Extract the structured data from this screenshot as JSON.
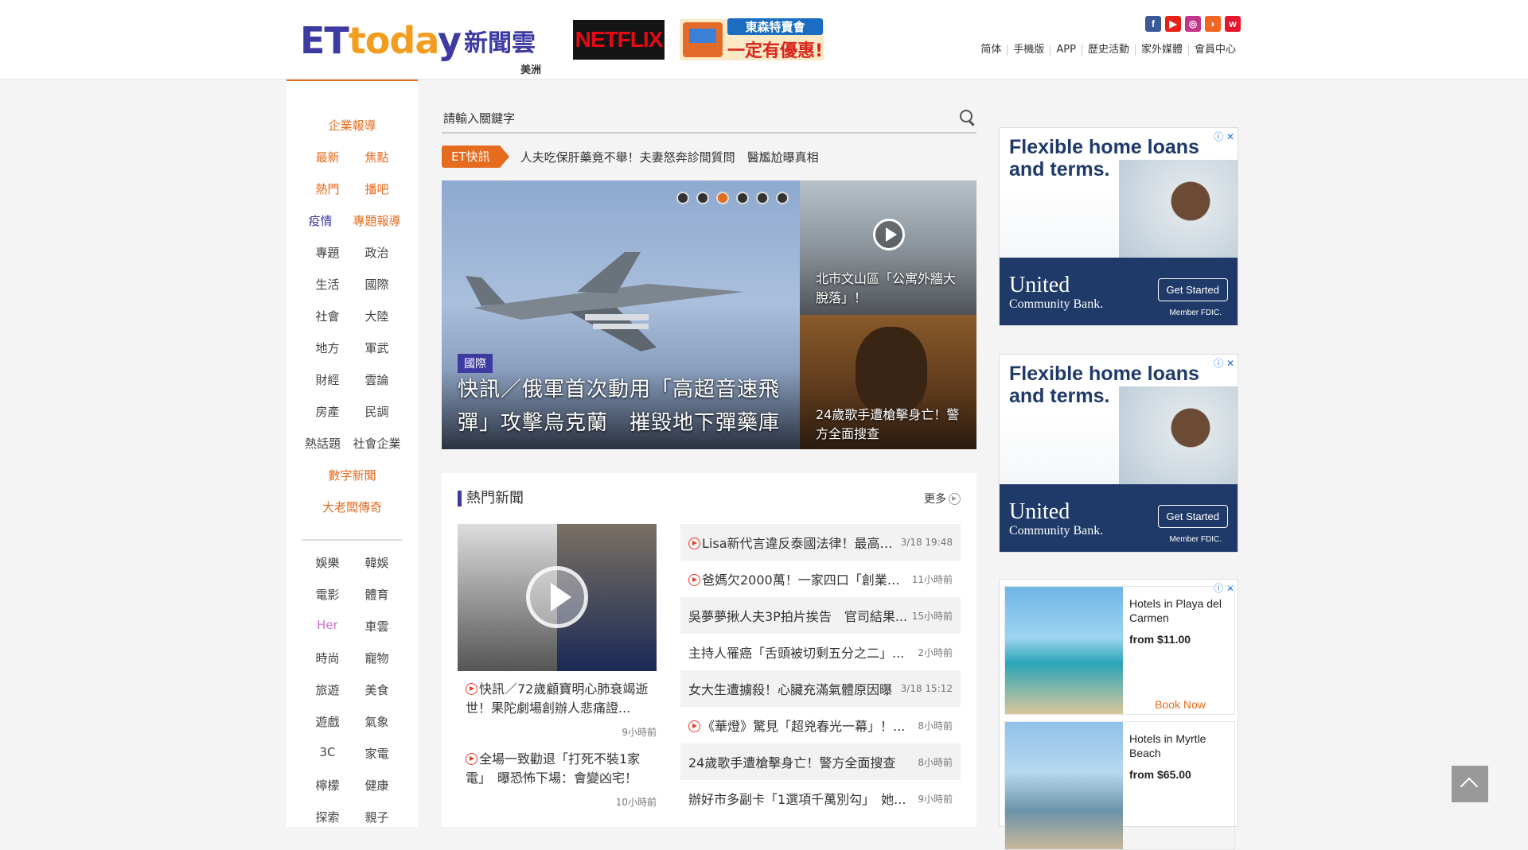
{
  "header": {
    "logo_en": "ETtoday",
    "logo_cn": "新聞雲",
    "region": "美洲",
    "netflix": "NETFLIX",
    "promo_line1": "東森特賣會",
    "promo_line2": "一定有優惠!",
    "social_icons": [
      "facebook-icon",
      "youtube-icon",
      "instagram-icon",
      "rss-icon",
      "weibo-icon"
    ],
    "nav": [
      "简体",
      "手機版",
      "APP",
      "歷史活動",
      "家外媒體",
      "會員中心"
    ]
  },
  "sidebar": {
    "rows": [
      [
        "企業報導"
      ],
      [
        "最新",
        "焦點"
      ],
      [
        "熱門",
        "播吧"
      ],
      [
        "疫情",
        "專題報導"
      ],
      [
        "專題",
        "政治"
      ],
      [
        "生活",
        "國際"
      ],
      [
        "社會",
        "大陸"
      ],
      [
        "地方",
        "軍武"
      ],
      [
        "財經",
        "雲論"
      ],
      [
        "房產",
        "民調"
      ],
      [
        "熱話題",
        "社會企業"
      ],
      [
        "數字新聞"
      ],
      [
        "大老闆傳奇"
      ],
      [
        "娛樂",
        "韓娛"
      ],
      [
        "電影",
        "體育"
      ],
      [
        "Her",
        "車雲"
      ],
      [
        "時尚",
        "寵物"
      ],
      [
        "旅遊",
        "美食"
      ],
      [
        "遊戲",
        "氣象"
      ],
      [
        "3C",
        "家電"
      ],
      [
        "檸檬",
        "健康"
      ],
      [
        "探索",
        "親子"
      ]
    ]
  },
  "search": {
    "placeholder": "請輸入關鍵字"
  },
  "flash": {
    "tag": "ET快訊",
    "text": "人夫吃保肝藥竟不舉！夫妻怒奔診間質問　醫尷尬曝真相"
  },
  "hero": {
    "category": "國際",
    "title": "快訊／俄軍首次動用「高超音速飛彈」攻擊烏克蘭　摧毀地下彈藥庫",
    "side1": "北市文山區「公寓外牆大脫落」！",
    "side2": "24歲歌手遭槍擊身亡！警方全面搜查"
  },
  "hot": {
    "heading": "熱門新聞",
    "more": "更多",
    "left": [
      {
        "title": "快訊／72歲顧寶明心肺衰竭逝世！果陀劇場創辦人悲痛證...",
        "time": "9小時前"
      },
      {
        "title": "全場一致勸退「打死不裝1家電」　曝恐怖下場：會變凶宅！",
        "time": "10小時前"
      }
    ],
    "right": [
      {
        "title": "Lisa新代言違反泰國法律！最高「...",
        "time": "3/18 19:48",
        "video": true
      },
      {
        "title": "爸媽欠2000萬！一家四口「創業賣...",
        "time": "11小時前",
        "video": true
      },
      {
        "title": "吳夢夢揪人夫3P拍片挨告　官司結果...",
        "time": "15小時前",
        "video": false
      },
      {
        "title": "主持人罹癌「舌頭被切剩五分之二」...",
        "time": "2小時前",
        "video": false
      },
      {
        "title": "女大生遭擄殺！心臟充滿氣體原因曝",
        "time": "3/18 15:12",
        "video": false
      },
      {
        "title": "《華燈》驚見「超兇春光一幕」！...",
        "time": "8小時前",
        "video": true
      },
      {
        "title": "24歲歌手遭槍擊身亡！警方全面搜查",
        "time": "8小時前",
        "video": false
      },
      {
        "title": "辦好市多副卡「1選項千萬別勾」　她...",
        "time": "9小時前",
        "video": false
      }
    ]
  },
  "ads": {
    "bank": {
      "headline_1": "Flexible home loans",
      "headline_2": "and terms.",
      "logo": "United",
      "logo_sub": "Community Bank.",
      "cta": "Get Started",
      "fdic": "Member FDIC."
    },
    "hotels": [
      {
        "name": "Hotels in Playa del Carmen",
        "price": "from $11.00",
        "cta": "Book Now"
      },
      {
        "name": "Hotels in Myrtle Beach",
        "price": "from $65.00"
      }
    ]
  }
}
